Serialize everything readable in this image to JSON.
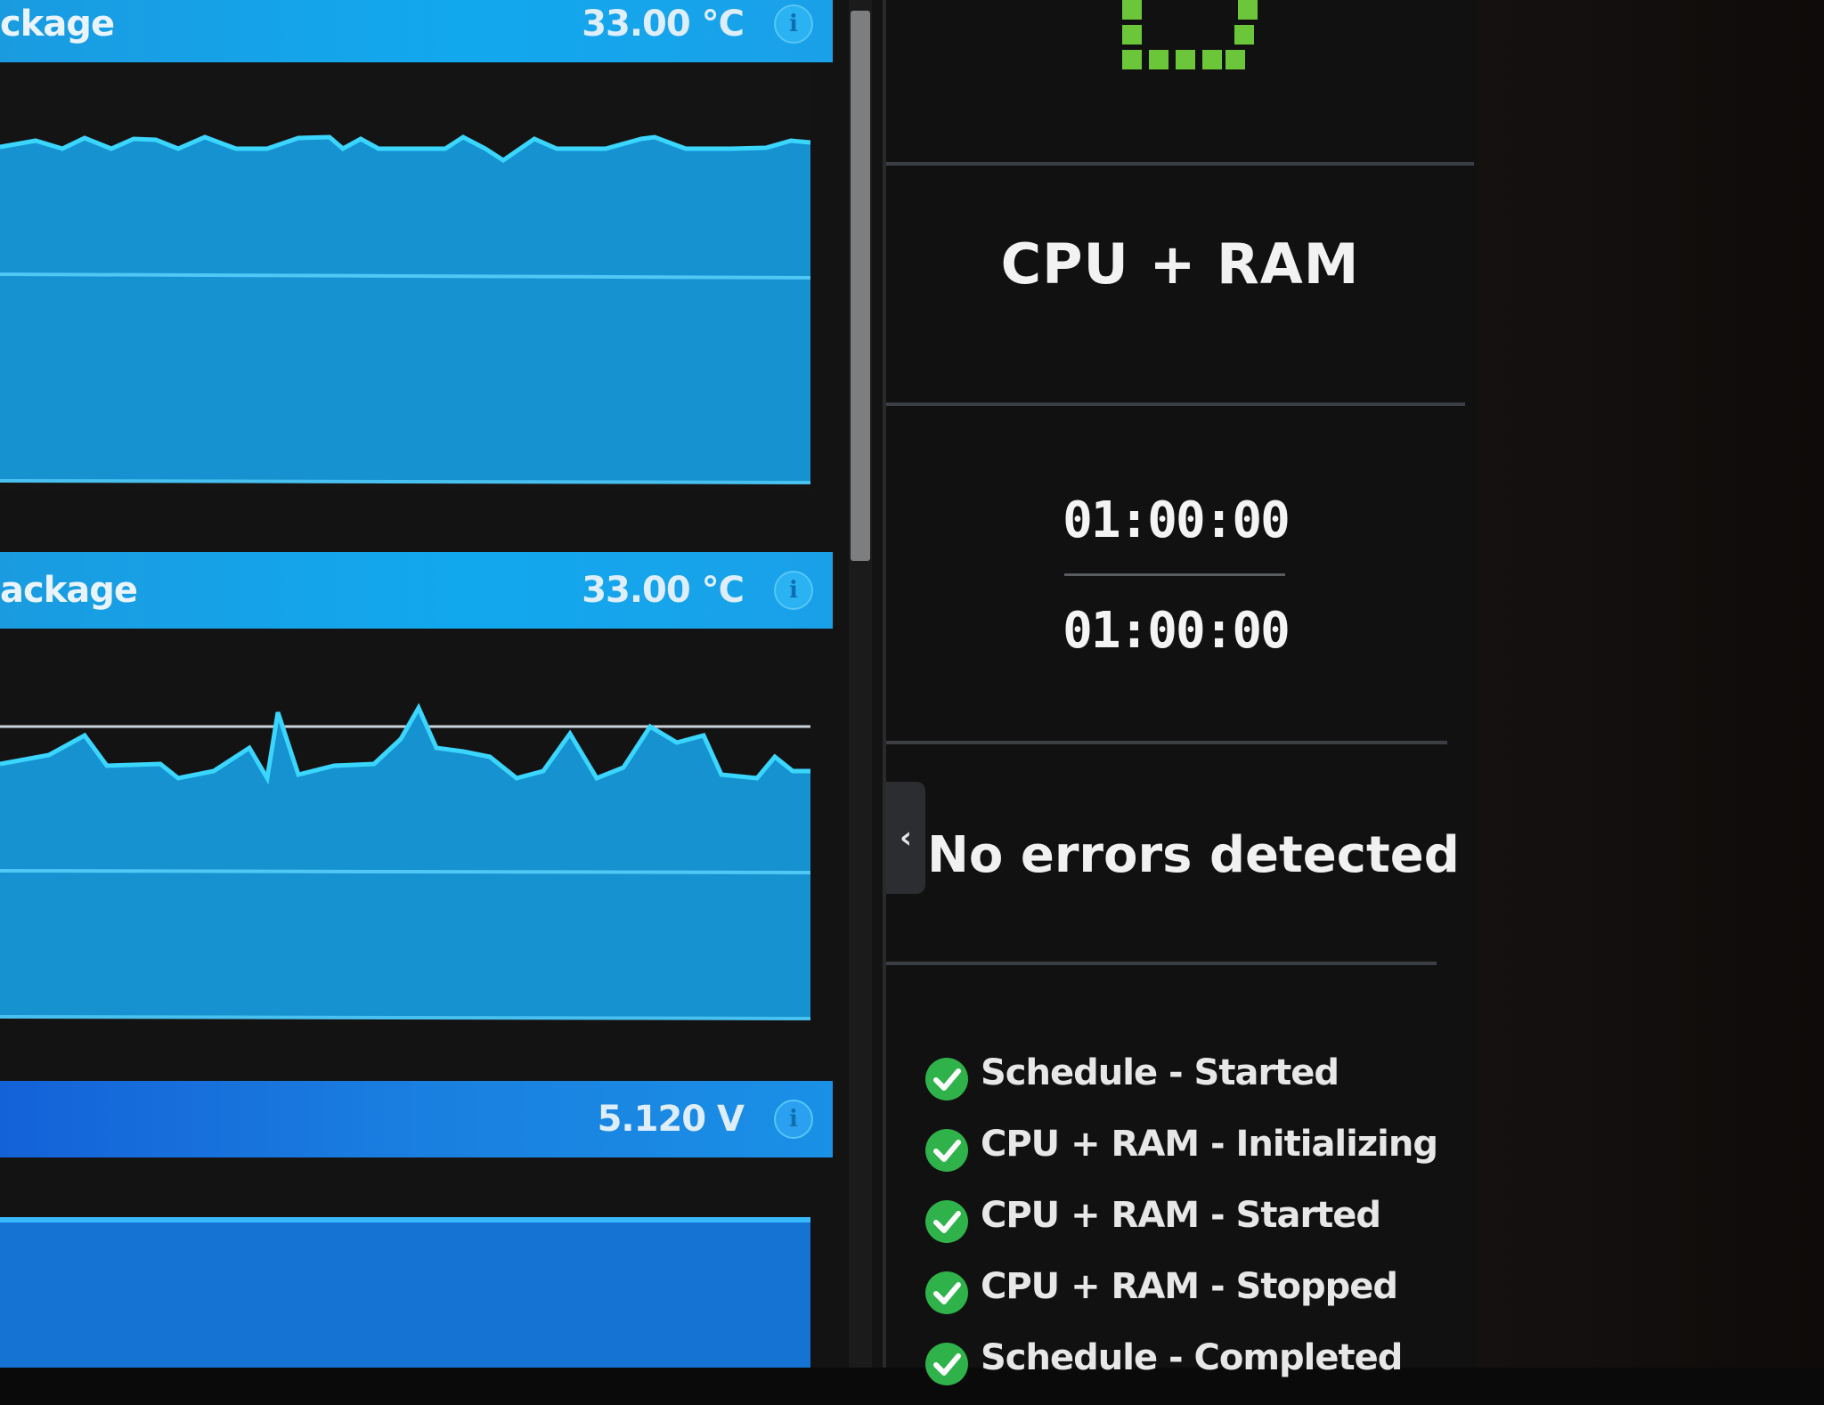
{
  "sensors": [
    {
      "name": "ckage",
      "value": "33.00 °C",
      "info_icon": "info-icon"
    },
    {
      "name": "ackage",
      "value": "33.00 °C",
      "info_icon": "info-icon"
    },
    {
      "name": "",
      "value": "5.120 V",
      "info_icon": "info-icon"
    }
  ],
  "colors": {
    "header_blue": "#12a8ee",
    "graph_fill": "#1592cf",
    "graph_line": "#3ad6ff",
    "success_green": "#2fb24a",
    "status_icon_green": "#6cc63a"
  },
  "status": {
    "icon": "status-grid-icon",
    "test_name": "CPU + RAM",
    "elapsed_time": "01:00:00",
    "total_time": "01:00:00",
    "collapse_icon": "chevron-left-icon",
    "result": "No errors detected"
  },
  "event_log": [
    {
      "text": "Schedule - Started",
      "icon": "check-circle-icon"
    },
    {
      "text": "CPU + RAM - Initializing",
      "icon": "check-circle-icon"
    },
    {
      "text": "CPU + RAM - Started",
      "icon": "check-circle-icon"
    },
    {
      "text": "CPU + RAM - Stopped",
      "icon": "check-circle-icon"
    },
    {
      "text": "Schedule - Completed",
      "icon": "check-circle-icon"
    }
  ]
}
